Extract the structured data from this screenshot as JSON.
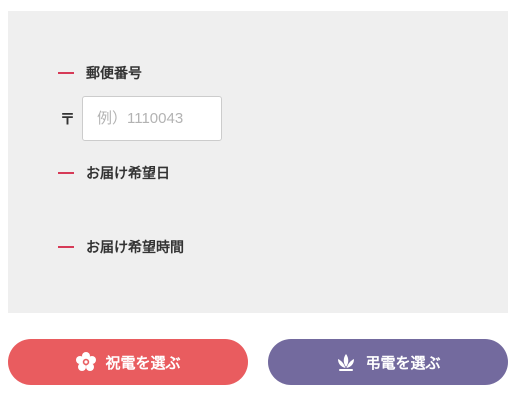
{
  "form": {
    "postal_label": "郵便番号",
    "postal_mark": "〒",
    "postal_placeholder": "例）1110043",
    "postal_value": "",
    "date_label": "お届け希望日",
    "time_label": "お届け希望時間"
  },
  "buttons": {
    "celebration_label": "祝電を選ぶ",
    "celebration_icon": "flower-icon",
    "condolence_label": "弔電を選ぶ",
    "condolence_icon": "lotus-icon"
  },
  "colors": {
    "accent_dash": "#d63a57",
    "celebration_button": "#e95c5f",
    "condolence_button": "#736a9e",
    "panel_background": "#efefef"
  }
}
